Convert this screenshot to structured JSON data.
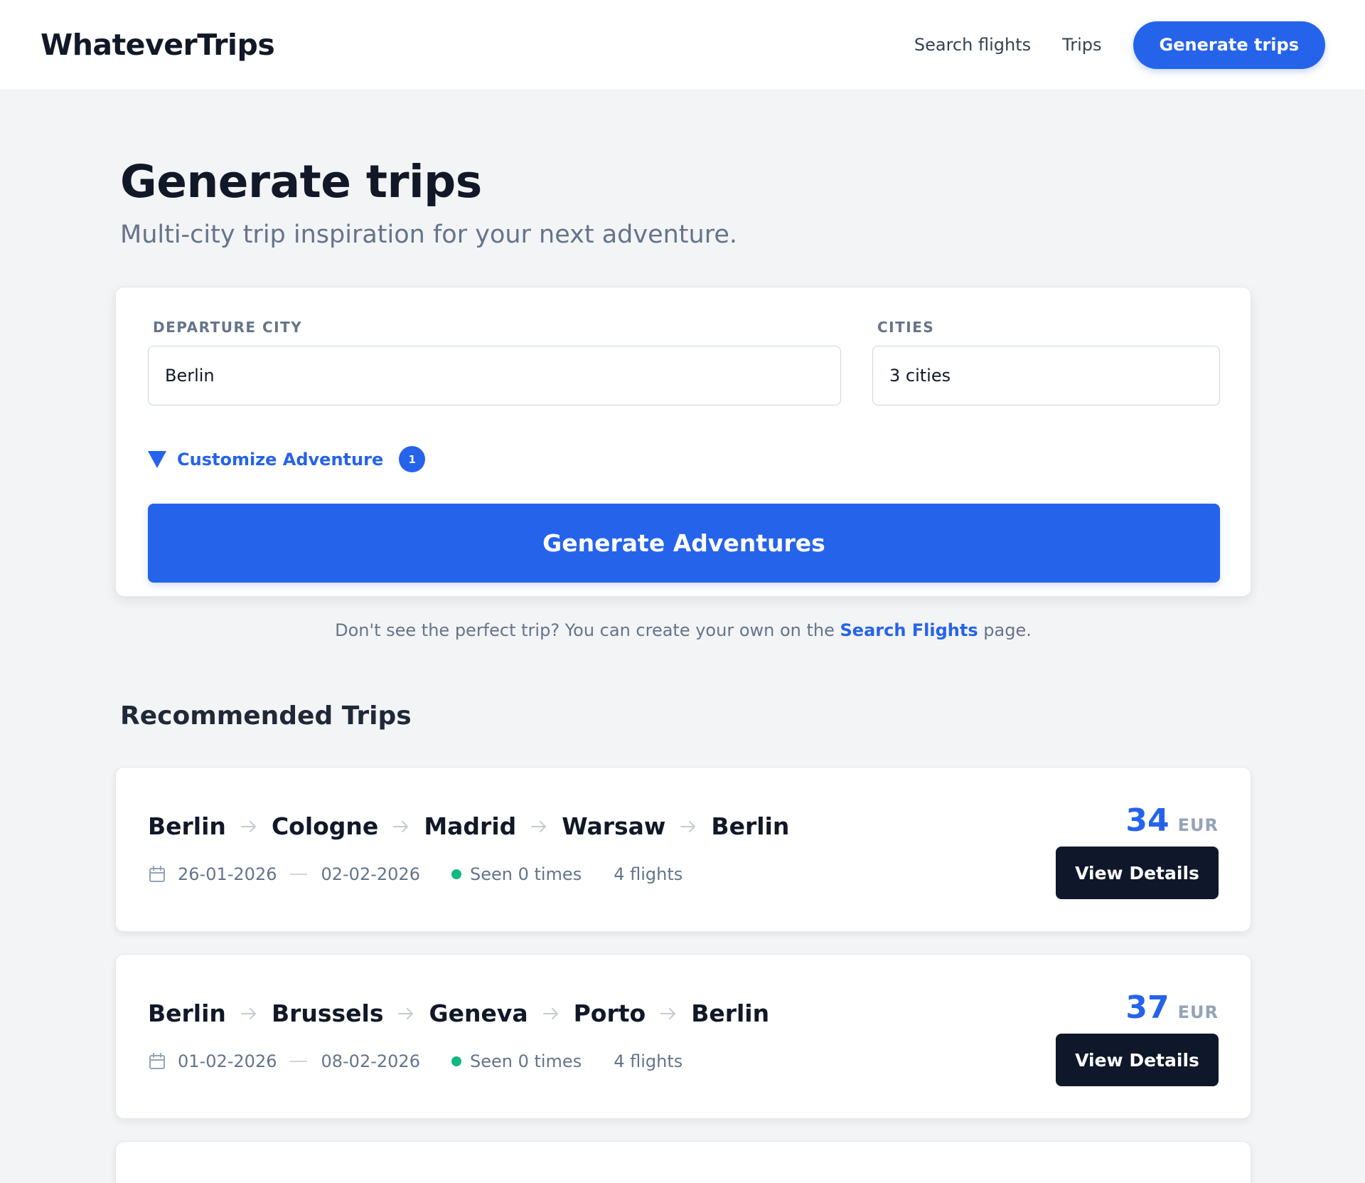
{
  "header": {
    "logo": "WhateverTrips",
    "nav": [
      {
        "label": "Search flights"
      },
      {
        "label": "Trips"
      }
    ],
    "cta_label": "Generate trips"
  },
  "page": {
    "title": "Generate trips",
    "subtitle": "Multi-city trip inspiration for your next adventure."
  },
  "form": {
    "departure_label": "DEPARTURE CITY",
    "departure_value": "Berlin",
    "cities_label": "CITIES",
    "cities_value": "3 cities",
    "customize_label": "Customize Adventure",
    "customize_badge": "1",
    "generate_label": "Generate Adventures"
  },
  "hint": {
    "text_before": "Don't see the perfect trip? You can create your own on the ",
    "link": "Search Flights",
    "text_after": " page."
  },
  "recommended": {
    "title": "Recommended Trips",
    "trips": [
      {
        "route": [
          "Berlin",
          "Cologne",
          "Madrid",
          "Warsaw",
          "Berlin"
        ],
        "start_date": "26-01-2026",
        "end_date": "02-02-2026",
        "seen": "Seen 0 times",
        "flights": "4 flights",
        "price": "34",
        "currency": "EUR",
        "button": "View Details"
      },
      {
        "route": [
          "Berlin",
          "Brussels",
          "Geneva",
          "Porto",
          "Berlin"
        ],
        "start_date": "01-02-2026",
        "end_date": "08-02-2026",
        "seen": "Seen 0 times",
        "flights": "4 flights",
        "price": "37",
        "currency": "EUR",
        "button": "View Details"
      }
    ]
  },
  "colors": {
    "accent": "#2563eb",
    "dark_button": "#0f172a",
    "status_dot": "#10b981",
    "background": "#f3f4f6"
  }
}
